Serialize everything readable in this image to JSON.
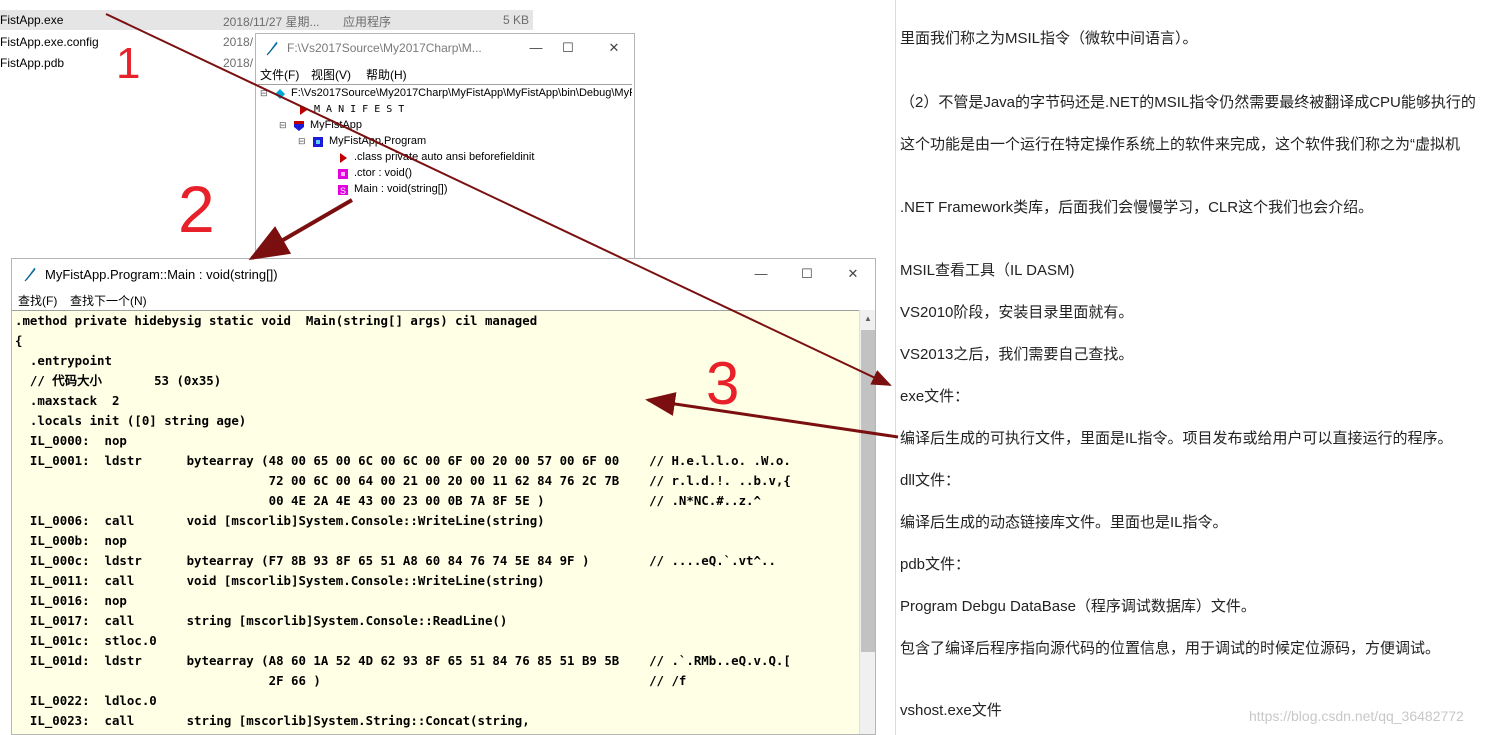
{
  "explorer": {
    "files": [
      {
        "name": "FistApp.exe",
        "date": "2018/11/27 星期...",
        "type": "应用程序",
        "size": "5 KB",
        "selected": true
      },
      {
        "name": "FistApp.exe.config",
        "date": "2018/",
        "type": "",
        "size": "",
        "selected": false
      },
      {
        "name": "FistApp.pdb",
        "date": "2018/",
        "type": "",
        "size": "",
        "selected": false
      }
    ]
  },
  "ildasm_tree_window": {
    "title": "F:\\Vs2017Source\\My2017Charp\\M...",
    "menu": [
      "文件(F)",
      "视图(V)",
      "帮助(H)"
    ],
    "controls": {
      "minimize": "—",
      "maximize": "☐",
      "close": "✕"
    },
    "tree": [
      {
        "label": "F:\\Vs2017Source\\My2017Charp\\MyFistApp\\MyFistApp\\bin\\Debug\\MyFi",
        "icon": "assembly-icon",
        "color": "#00a8d8"
      },
      {
        "label": "M A N I F E S T",
        "icon": "manifest-icon",
        "color": "#c00000"
      },
      {
        "label": "MyFistApp",
        "icon": "namespace-shield-icon",
        "color": "#1c1cd8"
      },
      {
        "label": "MyFistApp.Program",
        "icon": "class-icon",
        "color": "#1c1cd8"
      },
      {
        "label": ".class private auto ansi beforefieldinit",
        "icon": "class-info-icon",
        "color": "#c00000"
      },
      {
        "label": ".ctor : void()",
        "icon": "method-icon",
        "color": "#e000e0"
      },
      {
        "label": "Main : void(string[])",
        "icon": "static-method-icon",
        "color": "#e000e0"
      }
    ]
  },
  "code_window": {
    "title": "MyFistApp.Program::Main : void(string[])",
    "menu": [
      "查找(F)",
      "查找下一个(N)"
    ],
    "controls": {
      "minimize": "—",
      "maximize": "☐",
      "close": "✕"
    },
    "lines": [
      ".method private hidebysig static void  Main(string[] args) cil managed",
      "{",
      "  .entrypoint",
      "  // 代码大小       53 (0x35)",
      "  .maxstack  2",
      "  .locals init ([0] string age)",
      "  IL_0000:  nop",
      "  IL_0001:  ldstr      bytearray (48 00 65 00 6C 00 6C 00 6F 00 20 00 57 00 6F 00    // H.e.l.l.o. .W.o.",
      "                                  72 00 6C 00 64 00 21 00 20 00 11 62 84 76 2C 7B    // r.l.d.!. ..b.v,{",
      "                                  00 4E 2A 4E 43 00 23 00 0B 7A 8F 5E )              // .N*NC.#..z.^",
      "  IL_0006:  call       void [mscorlib]System.Console::WriteLine(string)",
      "  IL_000b:  nop",
      "  IL_000c:  ldstr      bytearray (F7 8B 93 8F 65 51 A8 60 84 76 74 5E 84 9F )        // ....eQ.`.vt^..",
      "  IL_0011:  call       void [mscorlib]System.Console::WriteLine(string)",
      "  IL_0016:  nop",
      "  IL_0017:  call       string [mscorlib]System.Console::ReadLine()",
      "  IL_001c:  stloc.0",
      "  IL_001d:  ldstr      bytearray (A8 60 1A 52 4D 62 93 8F 65 51 84 76 85 51 B9 5B    // .`.RMb..eQ.v.Q.[",
      "                                  2F 66 )                                            // /f",
      "  IL_0022:  ldloc.0",
      "  IL_0023:  call       string [mscorlib]System.String::Concat(string,"
    ]
  },
  "article": {
    "lines": [
      "里面我们称之为MSIL指令（微软中间语言）。",
      "（2）不管是Java的字节码还是.NET的MSIL指令仍然需要最终被翻译成CPU能够执行的",
      "这个功能是由一个运行在特定操作系统上的软件来完成，这个软件我们称之为“虚拟机",
      ".NET Framework类库，后面我们会慢慢学习，CLR这个我们也会介绍。",
      "MSIL查看工具（IL DASM)",
      "VS2010阶段，安装目录里面就有。",
      "VS2013之后，我们需要自己查找。",
      "exe文件：",
      "编译后生成的可执行文件，里面是IL指令。项目发布或给用户可以直接运行的程序。",
      "dll文件：",
      "编译后生成的动态链接库文件。里面也是IL指令。",
      "pdb文件：",
      "Program Debgu DataBase（程序调试数据库）文件。",
      "包含了编译后程序指向源代码的位置信息，用于调试的时候定位源码，方便调试。",
      "vshost.exe文件"
    ],
    "watermark": "https://blog.csdn.net/qq_36482772"
  },
  "annotations": {
    "marks": [
      "1",
      "2",
      "3"
    ],
    "pen_color": "#e8202a",
    "arrow_color": "#7b0f0f"
  }
}
